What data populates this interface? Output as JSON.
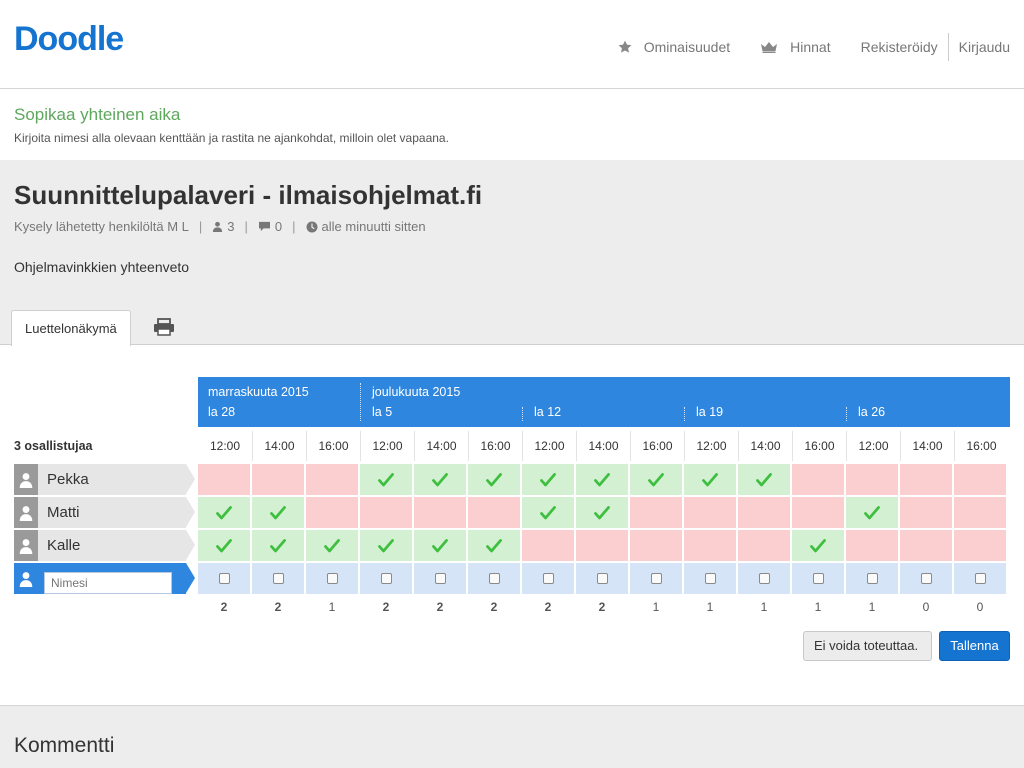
{
  "header": {
    "logo": "Doodle",
    "nav": {
      "features": "Ominaisuudet",
      "prices": "Hinnat",
      "register": "Rekisteröidy",
      "login": "Kirjaudu"
    }
  },
  "intro": {
    "title": "Sopikaa yhteinen aika",
    "instructions": "Kirjoita nimesi alla olevaan kenttään ja rastita ne ajankohdat, milloin olet vapaana."
  },
  "poll": {
    "title": "Suunnittelupalaveri - ilmaisohjelmat.fi",
    "sent_by": "Kysely lähetetty henkilöltä M L",
    "participants_count": "3",
    "comments_count": "0",
    "time_ago": "alle minuutti sitten",
    "description": "Ohjelmavinkkien yhteenveto"
  },
  "tabs": {
    "list_view": "Luettelonäkymä"
  },
  "table": {
    "months": [
      "marraskuuta 2015",
      "joulukuuta 2015"
    ],
    "days": [
      "la 28",
      "la 5",
      "la 12",
      "la 19",
      "la 26"
    ],
    "times": [
      "12:00",
      "14:00",
      "16:00",
      "12:00",
      "14:00",
      "16:00",
      "12:00",
      "14:00",
      "16:00",
      "12:00",
      "14:00",
      "16:00",
      "12:00",
      "14:00",
      "16:00"
    ],
    "participants_label": "3 osallistujaa",
    "participants": [
      {
        "name": "Pekka",
        "votes": [
          0,
          0,
          0,
          1,
          1,
          1,
          1,
          1,
          1,
          1,
          1,
          0,
          0,
          0,
          0
        ]
      },
      {
        "name": "Matti",
        "votes": [
          1,
          1,
          0,
          0,
          0,
          0,
          1,
          1,
          0,
          0,
          0,
          0,
          1,
          0,
          0
        ]
      },
      {
        "name": "Kalle",
        "votes": [
          1,
          1,
          1,
          1,
          1,
          1,
          0,
          0,
          0,
          0,
          0,
          1,
          0,
          0,
          0
        ]
      }
    ],
    "name_placeholder": "Nimesi",
    "totals": [
      "2",
      "2",
      "1",
      "2",
      "2",
      "2",
      "2",
      "2",
      "1",
      "1",
      "1",
      "1",
      "1",
      "0",
      "0"
    ]
  },
  "buttons": {
    "cannot_attend": "Ei voida toteuttaa.",
    "save": "Tallenna"
  },
  "comments": {
    "title": "Kommentti"
  },
  "colors": {
    "brand": "#1674d1",
    "header_blue": "#2f86de",
    "yes": "#d3f0d3",
    "no": "#fbcfcf",
    "check": "#3fbf3f",
    "intro_title": "#5da85d"
  }
}
